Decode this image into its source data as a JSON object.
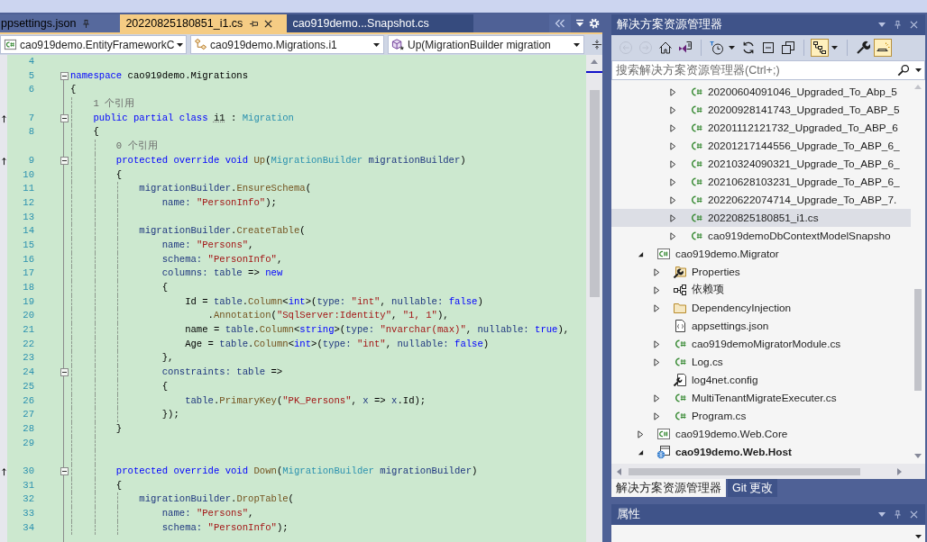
{
  "editor": {
    "tabs": [
      {
        "label": "ppsettings.json",
        "selected": false,
        "pinned": true
      },
      {
        "label": "20220825180851_i1.cs",
        "selected": true,
        "pinned": false
      },
      {
        "label": "cao919demo...Snapshot.cs",
        "selected": false,
        "pinned": false
      }
    ],
    "navigation_bar": {
      "project": "cao919demo.EntityFrameworkC",
      "type": "cao919demo.Migrations.i1",
      "member": "Up(MigrationBuilder migration"
    },
    "lines": [
      {
        "kind": "code",
        "number": "4",
        "fold": false,
        "inheritance_marker": false
      },
      {
        "kind": "code",
        "number": "5",
        "fold": true,
        "inheritance_marker": false,
        "tokens": [
          {
            "text": "namespace",
            "kind": "keyword"
          },
          {
            "text": " cao919demo.Migrations",
            "kind": "plain"
          }
        ]
      },
      {
        "kind": "code",
        "number": "6",
        "fold": false,
        "inheritance_marker": false,
        "tokens": [
          {
            "text": "{",
            "kind": "plain"
          }
        ]
      },
      {
        "kind": "codelens",
        "text": "1 个引用"
      },
      {
        "kind": "code",
        "number": "7",
        "fold": true,
        "inheritance_marker": true,
        "tokens": [
          {
            "text": "    public partial class ",
            "kind": "keyword"
          },
          {
            "text": "i1",
            "kind": "suggestion"
          },
          {
            "text": " : ",
            "kind": "plain"
          },
          {
            "text": "Migration",
            "kind": "type"
          }
        ]
      },
      {
        "kind": "code",
        "number": "8",
        "fold": false,
        "inheritance_marker": false,
        "tokens": [
          {
            "text": "    {",
            "kind": "plain"
          }
        ]
      },
      {
        "kind": "codelens",
        "text": "0 个引用"
      },
      {
        "kind": "code",
        "number": "9",
        "fold": true,
        "inheritance_marker": true,
        "tokens": [
          {
            "text": "        protected override void ",
            "kind": "keyword"
          },
          {
            "text": "Up",
            "kind": "method"
          },
          {
            "text": "(",
            "kind": "plain"
          },
          {
            "text": "MigrationBuilder",
            "kind": "type"
          },
          {
            "text": " migrationBuilder",
            "kind": "local"
          },
          {
            "text": ")",
            "kind": "plain"
          }
        ]
      },
      {
        "kind": "code",
        "number": "10",
        "fold": false,
        "inheritance_marker": false,
        "tokens": [
          {
            "text": "        {",
            "kind": "plain"
          }
        ]
      },
      {
        "kind": "code",
        "number": "11",
        "fold": false,
        "inheritance_marker": false,
        "tokens": [
          {
            "text": "            migrationBuilder",
            "kind": "local"
          },
          {
            "text": ".",
            "kind": "plain"
          },
          {
            "text": "EnsureSchema",
            "kind": "method"
          },
          {
            "text": "(",
            "kind": "plain"
          }
        ]
      },
      {
        "kind": "code",
        "number": "12",
        "fold": false,
        "inheritance_marker": false,
        "tokens": [
          {
            "text": "                name: ",
            "kind": "local"
          },
          {
            "text": "\"PersonInfo\"",
            "kind": "string"
          },
          {
            "text": ");",
            "kind": "plain"
          }
        ]
      },
      {
        "kind": "code",
        "number": "13",
        "fold": false,
        "inheritance_marker": false
      },
      {
        "kind": "code",
        "number": "14",
        "fold": false,
        "inheritance_marker": false,
        "tokens": [
          {
            "text": "            migrationBuilder",
            "kind": "local"
          },
          {
            "text": ".",
            "kind": "plain"
          },
          {
            "text": "CreateTable",
            "kind": "method"
          },
          {
            "text": "(",
            "kind": "plain"
          }
        ]
      },
      {
        "kind": "code",
        "number": "15",
        "fold": false,
        "inheritance_marker": false,
        "tokens": [
          {
            "text": "                name: ",
            "kind": "local"
          },
          {
            "text": "\"Persons\"",
            "kind": "string"
          },
          {
            "text": ",",
            "kind": "plain"
          }
        ]
      },
      {
        "kind": "code",
        "number": "16",
        "fold": false,
        "inheritance_marker": false,
        "tokens": [
          {
            "text": "                schema: ",
            "kind": "local"
          },
          {
            "text": "\"PersonInfo\"",
            "kind": "string"
          },
          {
            "text": ",",
            "kind": "plain"
          }
        ]
      },
      {
        "kind": "code",
        "number": "17",
        "fold": false,
        "inheritance_marker": false,
        "tokens": [
          {
            "text": "                columns: table",
            "kind": "local"
          },
          {
            "text": " => ",
            "kind": "plain"
          },
          {
            "text": "new",
            "kind": "keyword"
          }
        ]
      },
      {
        "kind": "code",
        "number": "18",
        "fold": false,
        "inheritance_marker": false,
        "tokens": [
          {
            "text": "                {",
            "kind": "plain"
          }
        ]
      },
      {
        "kind": "code",
        "number": "19",
        "fold": false,
        "inheritance_marker": false,
        "tokens": [
          {
            "text": "                    Id = ",
            "kind": "plain"
          },
          {
            "text": "table",
            "kind": "local"
          },
          {
            "text": ".",
            "kind": "plain"
          },
          {
            "text": "Column",
            "kind": "method"
          },
          {
            "text": "<",
            "kind": "plain"
          },
          {
            "text": "int",
            "kind": "keyword"
          },
          {
            "text": ">(",
            "kind": "plain"
          },
          {
            "text": "type: ",
            "kind": "local"
          },
          {
            "text": "\"int\"",
            "kind": "string"
          },
          {
            "text": ", ",
            "kind": "plain"
          },
          {
            "text": "nullable: ",
            "kind": "local"
          },
          {
            "text": "false",
            "kind": "keyword"
          },
          {
            "text": ")",
            "kind": "plain"
          }
        ]
      },
      {
        "kind": "code",
        "number": "20",
        "fold": false,
        "inheritance_marker": false,
        "tokens": [
          {
            "text": "                        .",
            "kind": "plain"
          },
          {
            "text": "Annotation",
            "kind": "method"
          },
          {
            "text": "(",
            "kind": "plain"
          },
          {
            "text": "\"SqlServer:Identity\"",
            "kind": "string"
          },
          {
            "text": ", ",
            "kind": "plain"
          },
          {
            "text": "\"1, 1\"",
            "kind": "string"
          },
          {
            "text": "),",
            "kind": "plain"
          }
        ]
      },
      {
        "kind": "code",
        "number": "21",
        "fold": false,
        "inheritance_marker": false,
        "tokens": [
          {
            "text": "                    name = ",
            "kind": "plain"
          },
          {
            "text": "table",
            "kind": "local"
          },
          {
            "text": ".",
            "kind": "plain"
          },
          {
            "text": "Column",
            "kind": "method"
          },
          {
            "text": "<",
            "kind": "plain"
          },
          {
            "text": "string",
            "kind": "keyword"
          },
          {
            "text": ">(",
            "kind": "plain"
          },
          {
            "text": "type: ",
            "kind": "local"
          },
          {
            "text": "\"nvarchar(max)\"",
            "kind": "string"
          },
          {
            "text": ", ",
            "kind": "plain"
          },
          {
            "text": "nullable: ",
            "kind": "local"
          },
          {
            "text": "true",
            "kind": "keyword"
          },
          {
            "text": "),",
            "kind": "plain"
          }
        ]
      },
      {
        "kind": "code",
        "number": "22",
        "fold": false,
        "inheritance_marker": false,
        "tokens": [
          {
            "text": "                    Age = ",
            "kind": "plain"
          },
          {
            "text": "table",
            "kind": "local"
          },
          {
            "text": ".",
            "kind": "plain"
          },
          {
            "text": "Column",
            "kind": "method"
          },
          {
            "text": "<",
            "kind": "plain"
          },
          {
            "text": "int",
            "kind": "keyword"
          },
          {
            "text": ">(",
            "kind": "plain"
          },
          {
            "text": "type: ",
            "kind": "local"
          },
          {
            "text": "\"int\"",
            "kind": "string"
          },
          {
            "text": ", ",
            "kind": "plain"
          },
          {
            "text": "nullable: ",
            "kind": "local"
          },
          {
            "text": "false",
            "kind": "keyword"
          },
          {
            "text": ")",
            "kind": "plain"
          }
        ]
      },
      {
        "kind": "code",
        "number": "23",
        "fold": false,
        "inheritance_marker": false,
        "tokens": [
          {
            "text": "                },",
            "kind": "plain"
          }
        ]
      },
      {
        "kind": "code",
        "number": "24",
        "fold": true,
        "inheritance_marker": false,
        "tokens": [
          {
            "text": "                constraints: table",
            "kind": "local"
          },
          {
            "text": " =>",
            "kind": "plain"
          }
        ]
      },
      {
        "kind": "code",
        "number": "25",
        "fold": false,
        "inheritance_marker": false,
        "tokens": [
          {
            "text": "                {",
            "kind": "plain"
          }
        ]
      },
      {
        "kind": "code",
        "number": "26",
        "fold": false,
        "inheritance_marker": false,
        "tokens": [
          {
            "text": "                    table",
            "kind": "local"
          },
          {
            "text": ".",
            "kind": "plain"
          },
          {
            "text": "PrimaryKey",
            "kind": "method"
          },
          {
            "text": "(",
            "kind": "plain"
          },
          {
            "text": "\"PK_Persons\"",
            "kind": "string"
          },
          {
            "text": ", ",
            "kind": "plain"
          },
          {
            "text": "x",
            "kind": "local"
          },
          {
            "text": " => ",
            "kind": "plain"
          },
          {
            "text": "x",
            "kind": "local"
          },
          {
            "text": ".Id);",
            "kind": "plain"
          }
        ]
      },
      {
        "kind": "code",
        "number": "27",
        "fold": false,
        "inheritance_marker": false,
        "tokens": [
          {
            "text": "                });",
            "kind": "plain"
          }
        ]
      },
      {
        "kind": "code",
        "number": "28",
        "fold": false,
        "inheritance_marker": false,
        "tokens": [
          {
            "text": "        }",
            "kind": "plain"
          }
        ]
      },
      {
        "kind": "code",
        "number": "29",
        "fold": false,
        "inheritance_marker": false
      },
      {
        "kind": "spacer"
      },
      {
        "kind": "code",
        "number": "30",
        "fold": true,
        "inheritance_marker": true,
        "tokens": [
          {
            "text": "        protected override void ",
            "kind": "keyword"
          },
          {
            "text": "Down",
            "kind": "method"
          },
          {
            "text": "(",
            "kind": "plain"
          },
          {
            "text": "MigrationBuilder",
            "kind": "type"
          },
          {
            "text": " migrationBuilder",
            "kind": "local"
          },
          {
            "text": ")",
            "kind": "plain"
          }
        ]
      },
      {
        "kind": "code",
        "number": "31",
        "fold": false,
        "inheritance_marker": false,
        "tokens": [
          {
            "text": "        {",
            "kind": "plain"
          }
        ]
      },
      {
        "kind": "code",
        "number": "32",
        "fold": false,
        "inheritance_marker": false,
        "tokens": [
          {
            "text": "            migrationBuilder",
            "kind": "local"
          },
          {
            "text": ".",
            "kind": "plain"
          },
          {
            "text": "DropTable",
            "kind": "method"
          },
          {
            "text": "(",
            "kind": "plain"
          }
        ]
      },
      {
        "kind": "code",
        "number": "33",
        "fold": false,
        "inheritance_marker": false,
        "tokens": [
          {
            "text": "                name: ",
            "kind": "local"
          },
          {
            "text": "\"Persons\"",
            "kind": "string"
          },
          {
            "text": ",",
            "kind": "plain"
          }
        ]
      },
      {
        "kind": "code",
        "number": "34",
        "fold": false,
        "inheritance_marker": false,
        "tokens": [
          {
            "text": "                schema: ",
            "kind": "local"
          },
          {
            "text": "\"PersonInfo\"",
            "kind": "string"
          },
          {
            "text": ");",
            "kind": "plain"
          }
        ]
      }
    ]
  },
  "solution_explorer": {
    "title": "解决方案资源管理器",
    "toolbar": [
      [
        {
          "kind": "back",
          "disabled": true,
          "on": false,
          "dropdown": false
        },
        {
          "kind": "forward",
          "disabled": true,
          "on": false,
          "dropdown": false
        },
        {
          "kind": "home",
          "disabled": false,
          "on": false,
          "dropdown": false
        },
        {
          "kind": "solution",
          "disabled": false,
          "on": false,
          "dropdown": false
        }
      ],
      [
        {
          "kind": "clock",
          "disabled": false,
          "on": false,
          "dropdown": true
        },
        {
          "kind": "refresh",
          "disabled": false,
          "on": false,
          "dropdown": false
        },
        {
          "kind": "collapse",
          "disabled": false,
          "on": false,
          "dropdown": false
        },
        {
          "kind": "copy",
          "disabled": false,
          "on": false,
          "dropdown": false
        }
      ],
      [
        {
          "kind": "hierarchy",
          "disabled": false,
          "on": true,
          "dropdown": true
        }
      ],
      [
        {
          "kind": "wrench",
          "disabled": false,
          "on": false,
          "dropdown": false
        },
        {
          "kind": "tray",
          "disabled": false,
          "on": true,
          "dropdown": false
        }
      ]
    ],
    "search": {
      "placeholder": "搜索解决方案资源管理器(Ctrl+;)"
    },
    "tree": [
      {
        "children": [
          {
            "children": [
              {
                "label": "20200604091046_Upgraded_To_Abp_5",
                "kind": "csharp-file",
                "expanded": false,
                "selected": false,
                "startup": false
              },
              {
                "label": "20200928141743_Upgraded_To_ABP_5",
                "kind": "csharp-file",
                "expanded": false,
                "selected": false,
                "startup": false
              },
              {
                "label": "20201112121732_Upgraded_To_ABP_6",
                "kind": "csharp-file",
                "expanded": false,
                "selected": false,
                "startup": false
              },
              {
                "label": "20201217144556_Upgrade_To_ABP_6_",
                "kind": "csharp-file",
                "expanded": false,
                "selected": false,
                "startup": false
              },
              {
                "label": "20210324090321_Upgrade_To_ABP_6_",
                "kind": "csharp-file",
                "expanded": false,
                "selected": false,
                "startup": false
              },
              {
                "label": "20210628103231_Upgrade_To_ABP_6_",
                "kind": "csharp-file",
                "expanded": false,
                "selected": false,
                "startup": false
              },
              {
                "label": "20220622074714_Upgrade_To_ABP_7.",
                "kind": "csharp-file",
                "expanded": false,
                "selected": false,
                "startup": false
              },
              {
                "label": "20220825180851_i1.cs",
                "kind": "csharp-file",
                "expanded": false,
                "selected": true,
                "startup": false
              },
              {
                "label": "cao919demoDbContextModelSnapsho",
                "kind": "csharp-file",
                "expanded": false,
                "selected": false,
                "startup": false
              }
            ]
          }
        ]
      },
      {
        "label": "cao919demo.Migrator",
        "kind": "csharp-project",
        "expanded": true,
        "selected": false,
        "startup": false,
        "children": [
          {
            "label": "Properties",
            "kind": "properties",
            "expanded": false,
            "selected": false,
            "startup": false
          },
          {
            "label": "依赖项",
            "kind": "dependencies",
            "expanded": false,
            "selected": false,
            "startup": false
          },
          {
            "label": "DependencyInjection",
            "kind": "folder",
            "expanded": false,
            "selected": false,
            "startup": false
          },
          {
            "label": "appsettings.json",
            "kind": "json-file",
            "selected": false,
            "startup": false
          },
          {
            "label": "cao919demoMigratorModule.cs",
            "kind": "csharp-file",
            "expanded": false,
            "selected": false,
            "startup": false
          },
          {
            "label": "Log.cs",
            "kind": "csharp-file",
            "expanded": false,
            "selected": false,
            "startup": false
          },
          {
            "label": "log4net.config",
            "kind": "config-file",
            "selected": false,
            "startup": false
          },
          {
            "label": "MultiTenantMigrateExecuter.cs",
            "kind": "csharp-file",
            "expanded": false,
            "selected": false,
            "startup": false
          },
          {
            "label": "Program.cs",
            "kind": "csharp-file",
            "expanded": false,
            "selected": false,
            "startup": false
          }
        ]
      },
      {
        "label": "cao919demo.Web.Core",
        "kind": "csharp-project",
        "expanded": false,
        "selected": false,
        "startup": false
      },
      {
        "label": "cao919demo.Web.Host",
        "kind": "web-project",
        "expanded": true,
        "selected": false,
        "startup": true
      }
    ],
    "tabs": [
      {
        "label": "解决方案资源管理器",
        "selected": true
      },
      {
        "label": "Git 更改",
        "selected": false
      }
    ]
  },
  "properties_panel": {
    "title": "属性"
  }
}
